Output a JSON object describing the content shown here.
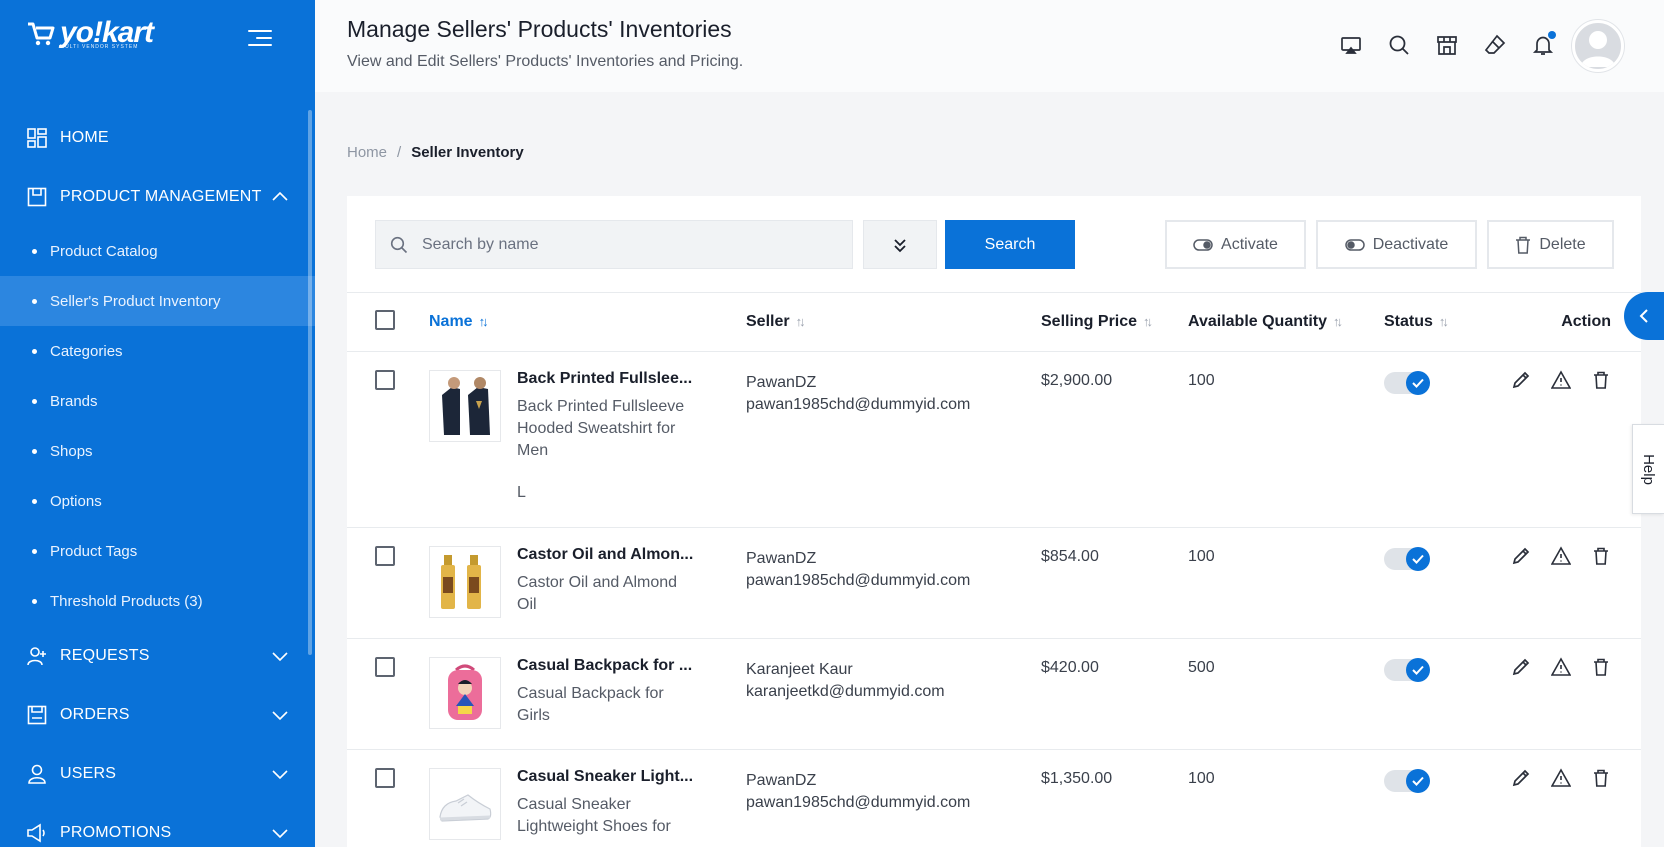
{
  "brand": {
    "name": "yo!kart",
    "tagline": "MULTI VENDOR SYSTEM"
  },
  "sidebar": {
    "items": [
      {
        "label": "HOME",
        "icon": "dashboard-icon"
      },
      {
        "label": "PRODUCT MANAGEMENT",
        "icon": "box-icon",
        "expanded": true
      },
      {
        "label": "REQUESTS",
        "icon": "user-plus-icon"
      },
      {
        "label": "ORDERS",
        "icon": "orders-icon"
      },
      {
        "label": "USERS",
        "icon": "user-icon"
      },
      {
        "label": "PROMOTIONS",
        "icon": "megaphone-icon"
      }
    ],
    "sub_items": [
      {
        "label": "Product Catalog"
      },
      {
        "label": "Seller's Product Inventory",
        "active": true
      },
      {
        "label": "Categories"
      },
      {
        "label": "Brands"
      },
      {
        "label": "Shops"
      },
      {
        "label": "Options"
      },
      {
        "label": "Product Tags"
      },
      {
        "label": "Threshold Products (3)"
      }
    ]
  },
  "header": {
    "title": "Manage Sellers' Products' Inventories",
    "subtitle": "View and Edit Sellers' Products' Inventories and Pricing."
  },
  "breadcrumb": {
    "home": "Home",
    "separator": "/",
    "current": "Seller Inventory"
  },
  "toolbar": {
    "search_placeholder": "Search by name",
    "search_label": "Search",
    "activate_label": "Activate",
    "deactivate_label": "Deactivate",
    "delete_label": "Delete"
  },
  "table": {
    "columns": {
      "name": "Name",
      "seller": "Seller",
      "price": "Selling Price",
      "qty": "Available Quantity",
      "status": "Status",
      "action": "Action"
    },
    "rows": [
      {
        "title": "Back Printed Fullslee...",
        "desc": "Back Printed Fullsleeve Hooded Sweatshirt for Men",
        "variant": "L",
        "seller_name": "PawanDZ",
        "seller_email": "pawan1985chd@dummyid.com",
        "price": "$2,900.00",
        "qty": "100",
        "status": "active"
      },
      {
        "title": "Castor Oil and Almon...",
        "desc": "Castor Oil and Almond Oil",
        "variant": "",
        "seller_name": "PawanDZ",
        "seller_email": "pawan1985chd@dummyid.com",
        "price": "$854.00",
        "qty": "100",
        "status": "active"
      },
      {
        "title": "Casual Backpack for ...",
        "desc": "Casual Backpack for Girls",
        "variant": "",
        "seller_name": "Karanjeet Kaur",
        "seller_email": "karanjeetkd@dummyid.com",
        "price": "$420.00",
        "qty": "500",
        "status": "active"
      },
      {
        "title": "Casual Sneaker Light...",
        "desc": "Casual Sneaker Lightweight Shoes for",
        "variant": "",
        "seller_name": "PawanDZ",
        "seller_email": "pawan1985chd@dummyid.com",
        "price": "$1,350.00",
        "qty": "100",
        "status": "active"
      }
    ]
  },
  "help": {
    "label": "Help"
  },
  "colors": {
    "primary": "#0a72d8",
    "sidebar_active": "#2c86e0"
  }
}
